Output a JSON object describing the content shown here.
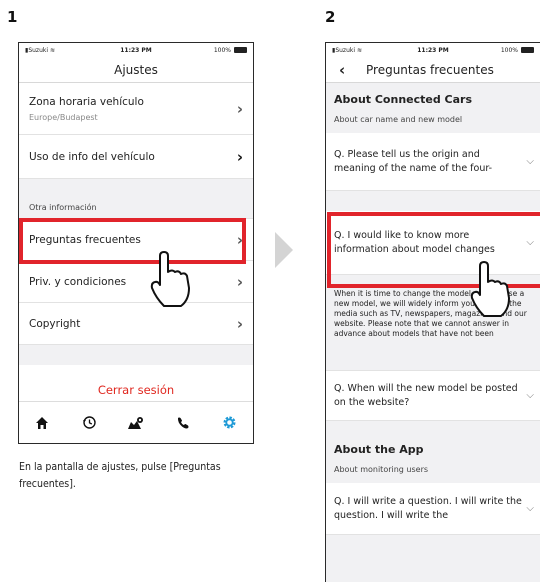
{
  "steps": {
    "step1": "1",
    "step2": "2"
  },
  "status_bar": {
    "carrier": "Suzuki",
    "time": "11:23 PM",
    "battery": "100%"
  },
  "settings_screen": {
    "title": "Ajustes",
    "items": [
      {
        "label": "Zona horaria vehículo",
        "sub": "Europe/Budapest"
      },
      {
        "label": "Uso de info del vehículo"
      }
    ],
    "section_label": "Otra información",
    "other_items": [
      {
        "label": "Preguntas frecuentes"
      },
      {
        "label": "Priv. y condiciones"
      },
      {
        "label": "Copyright"
      }
    ],
    "logout": "Cerrar sesión",
    "tabs": [
      "home-icon",
      "history-icon",
      "map-icon",
      "phone-icon",
      "settings-gear-icon"
    ]
  },
  "caption": "En la pantalla de ajustes, pulse [Preguntas frecuentes].",
  "faq_screen": {
    "title": "Preguntas frecuentes",
    "sections": [
      {
        "header": "About Connected Cars",
        "sub": "About car name and new model",
        "questions": [
          {
            "q": "Q. Please tell us the origin and meaning of the name of the four-"
          },
          {
            "q": "Q. I would like to know more information about model changes",
            "answer": "When it is time to change the model and release a new model, we will widely inform you through the media such as TV, newspapers, magazines and our website. Please note that we cannot answer in advance about models that have not been"
          },
          {
            "q": "Q. When will the new model be posted on the website?"
          }
        ]
      },
      {
        "header": "About the App",
        "sub": "About monitoring users",
        "questions": [
          {
            "q": "Q. I will write a question. I will write the question. I will write the"
          }
        ]
      }
    ]
  },
  "colors": {
    "highlight": "#e1242b",
    "logout": "#e0271f",
    "active_tab": "#1e9ad6",
    "arrow": "#d4d4d4"
  }
}
